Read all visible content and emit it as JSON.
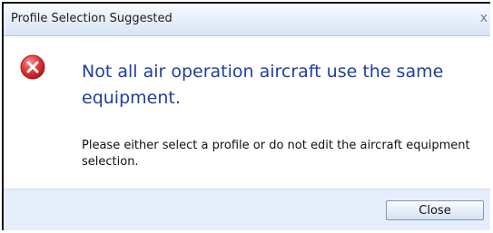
{
  "dialog": {
    "title": "Profile Selection Suggested",
    "close_glyph": "x",
    "icon": "error-icon",
    "main_message": "Not all air operation aircraft use the same equipment.",
    "detail_message": "Please either select a profile or do not edit the aircraft equipment selection.",
    "close_button_label": "Close"
  },
  "colors": {
    "title_gradient_top": "#f8fbff",
    "title_gradient_bottom": "#d9e5f4",
    "main_message_text": "#1f3fa3",
    "error_icon": "#d8282d",
    "footer_background": "#e5eefa"
  }
}
